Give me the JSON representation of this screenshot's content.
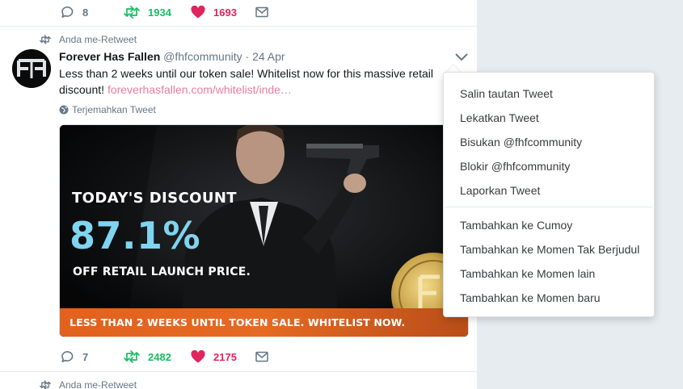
{
  "colors": {
    "accent_red": "#e0245e",
    "retweet_green": "#17bf63",
    "muted": "#657786",
    "bg": "#e6ecf0"
  },
  "prev_tweet": {
    "reply_count": "8",
    "retweet_count": "1934",
    "like_count": "1693"
  },
  "tweet": {
    "retweeted_by": "Anda me-Retweet",
    "author_name": "Forever Has Fallen",
    "author_handle": "@fhfcommunity",
    "separator": "·",
    "date": "24 Apr",
    "text": "Less than 2 weeks until our token sale! Whitelist now for this massive retail discount!",
    "link": "foreverhasfallen.com/whitelist/inde…",
    "translate": "Terjemahkan Tweet",
    "media": {
      "headline": "TODAY'S DISCOUNT",
      "percent": "87.1%",
      "subline": "OFF RETAIL LAUNCH PRICE.",
      "banner": "LESS THAN 2 WEEKS UNTIL TOKEN SALE. WHITELIST NOW."
    },
    "reply_count": "7",
    "retweet_count": "2482",
    "like_count": "2175"
  },
  "next_tweet": {
    "retweeted_by": "Anda me-Retweet"
  },
  "menu": {
    "items": [
      "Salin tautan Tweet",
      "Lekatkan Tweet",
      "Bisukan @fhfcommunity",
      "Blokir @fhfcommunity",
      "Laporkan Tweet"
    ],
    "moment_items": [
      "Tambahkan ke Cumoy",
      "Tambahkan ke Momen Tak Berjudul",
      "Tambahkan ke Momen lain",
      "Tambahkan ke Momen baru"
    ]
  },
  "icons": [
    "reply-icon",
    "retweet-icon",
    "heart-icon",
    "dm-icon",
    "globe-icon",
    "chevron-down-icon"
  ]
}
